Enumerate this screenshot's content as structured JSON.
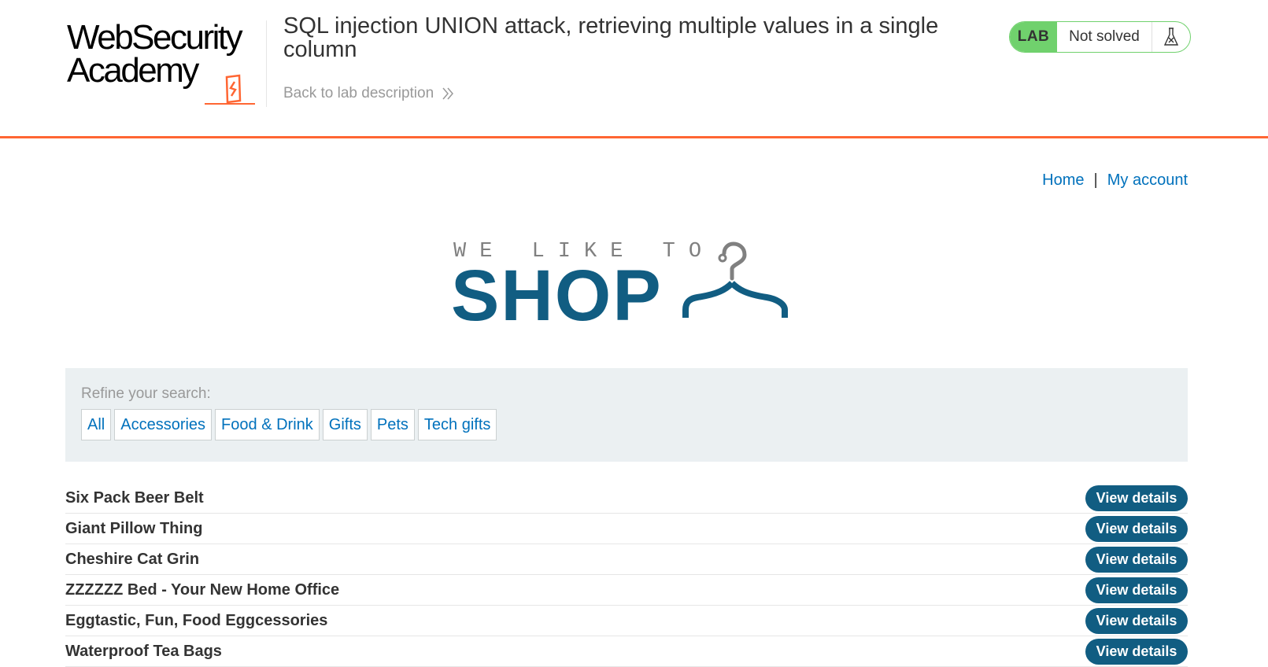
{
  "header": {
    "logo_line1": "WebSecurity",
    "logo_line2": "Academy",
    "lab_title": "SQL injection UNION attack, retrieving multiple values in a single column",
    "back_link": "Back to lab description",
    "lab_badge": "LAB",
    "lab_status": "Not solved"
  },
  "nav": {
    "home": "Home",
    "separator": "|",
    "my_account": "My account"
  },
  "banner": {
    "tagline": "WE LIKE TO",
    "word": "SHOP"
  },
  "filters": {
    "label": "Refine your search:",
    "items": [
      "All",
      "Accessories",
      "Food & Drink",
      "Gifts",
      "Pets",
      "Tech gifts"
    ]
  },
  "products": {
    "button_label": "View details",
    "items": [
      "Six Pack Beer Belt",
      "Giant Pillow Thing",
      "Cheshire Cat Grin",
      "ZZZZZZ Bed - Your New Home Office",
      "Eggtastic, Fun, Food Eggcessories",
      "Waterproof Tea Bags"
    ]
  },
  "colors": {
    "accent_orange": "#ff6633",
    "brand_blue": "#115d82",
    "link_blue": "#0071bc",
    "lab_green": "#70d16d",
    "filter_bg": "#ebf0f2"
  },
  "icons": {
    "logo_mark": "academy-logo-icon",
    "back": "double-chevron-right-icon",
    "flask": "flask-icon",
    "hanger": "hanger-icon"
  }
}
